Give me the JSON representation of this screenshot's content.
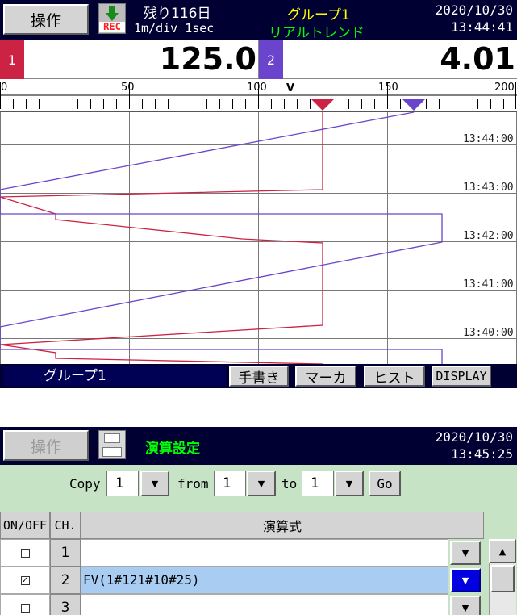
{
  "trend_screen": {
    "header": {
      "operation_button": "操作",
      "rec_label": "REC",
      "remaining": "残り116日",
      "division": "1m/div 1sec",
      "group_name": "グループ1",
      "mode": "リアルトレンド",
      "date": "2020/10/30",
      "time": "13:44:41",
      "rec_arrow_color": "#1a8a1a"
    },
    "digital": [
      {
        "channel": "1",
        "value": "125.0",
        "color": "#cc2244"
      },
      {
        "channel": "2",
        "value": "4.01",
        "color": "#6a44cc"
      }
    ],
    "scale": {
      "ticks": [
        "0",
        "50",
        "100",
        "150",
        "200"
      ],
      "unit": "V"
    },
    "time_labels": [
      "13:44:00",
      "13:43:00",
      "13:42:00",
      "13:41:00",
      "13:40:00"
    ],
    "bottom_bar": {
      "group": "グループ1",
      "buttons": [
        "手書き",
        "マーカ",
        "ヒスト",
        "DISPLAY"
      ]
    }
  },
  "calc_screen": {
    "header": {
      "operation_button": "操作",
      "title": "演算設定",
      "date": "2020/10/30",
      "time": "13:45:25"
    },
    "copy_bar": {
      "copy_label": "Copy",
      "copy_value": "1",
      "from_label": "from",
      "from_value": "1",
      "to_label": "to",
      "to_value": "1",
      "go_label": "Go"
    },
    "table": {
      "col_onoff": "ON/OFF",
      "col_ch": "CH.",
      "col_expr": "演算式",
      "rows": [
        {
          "checked": false,
          "ch": "1",
          "expr": ""
        },
        {
          "checked": true,
          "ch": "2",
          "expr": "FV(1#121#10#25)"
        },
        {
          "checked": false,
          "ch": "3",
          "expr": ""
        }
      ]
    }
  }
}
